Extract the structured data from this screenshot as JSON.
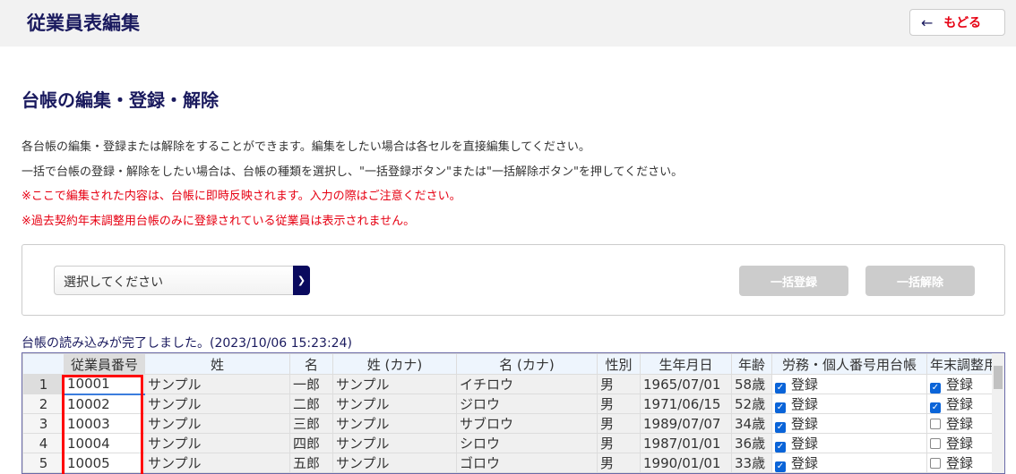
{
  "header": {
    "title": "従業員表編集",
    "back_label": "もどる"
  },
  "section_title": "台帳の編集・登録・解除",
  "descriptions": [
    "各台帳の編集・登録または解除をすることができます。編集をしたい場合は各セルを直接編集してください。",
    "一括で台帳の登録・解除をしたい場合は、台帳の種類を選択し、\"一括登録ボタン\"または\"一括解除ボタン\"を押してください。",
    "※ここで編集された内容は、台帳に即時反映されます。入力の際はご注意ください。",
    "※過去契約年末調整用台帳のみに登録されている従業員は表示されません。"
  ],
  "controls": {
    "select_value": "選択してください",
    "bulk_register": "一括登録",
    "bulk_release": "一括解除"
  },
  "status": "台帳の読み込みが完了しました。(2023/10/06 15:23:24)",
  "table": {
    "columns": [
      "",
      "従業員番号",
      "姓",
      "名",
      "姓 (カナ)",
      "名 (カナ)",
      "性別",
      "生年月日",
      "年齢",
      "労務・個人番号用台帳",
      "年末調整用"
    ],
    "rows": [
      {
        "n": "1",
        "id": "10001",
        "sei": "サンプル",
        "mei": "一郎",
        "sei_kana": "サンプル",
        "mei_kana": "イチロウ",
        "sex": "男",
        "birth": "1965/07/01",
        "age": "58歳",
        "romu": true,
        "romu_label": "登録",
        "nenmatsu": true,
        "nenmatsu_label": "登録"
      },
      {
        "n": "2",
        "id": "10002",
        "sei": "サンプル",
        "mei": "二郎",
        "sei_kana": "サンプル",
        "mei_kana": "ジロウ",
        "sex": "男",
        "birth": "1971/06/15",
        "age": "52歳",
        "romu": true,
        "romu_label": "登録",
        "nenmatsu": true,
        "nenmatsu_label": "登録"
      },
      {
        "n": "3",
        "id": "10003",
        "sei": "サンプル",
        "mei": "三郎",
        "sei_kana": "サンプル",
        "mei_kana": "サブロウ",
        "sex": "男",
        "birth": "1989/07/07",
        "age": "34歳",
        "romu": true,
        "romu_label": "登録",
        "nenmatsu": false,
        "nenmatsu_label": "登録"
      },
      {
        "n": "4",
        "id": "10004",
        "sei": "サンプル",
        "mei": "四郎",
        "sei_kana": "サンプル",
        "mei_kana": "シロウ",
        "sex": "男",
        "birth": "1987/01/01",
        "age": "36歳",
        "romu": true,
        "romu_label": "登録",
        "nenmatsu": false,
        "nenmatsu_label": "登録"
      },
      {
        "n": "5",
        "id": "10005",
        "sei": "サンプル",
        "mei": "五郎",
        "sei_kana": "サンプル",
        "mei_kana": "ゴロウ",
        "sex": "男",
        "birth": "1990/01/01",
        "age": "33歳",
        "romu": true,
        "romu_label": "登録",
        "nenmatsu": false,
        "nenmatsu_label": "登録"
      }
    ]
  }
}
